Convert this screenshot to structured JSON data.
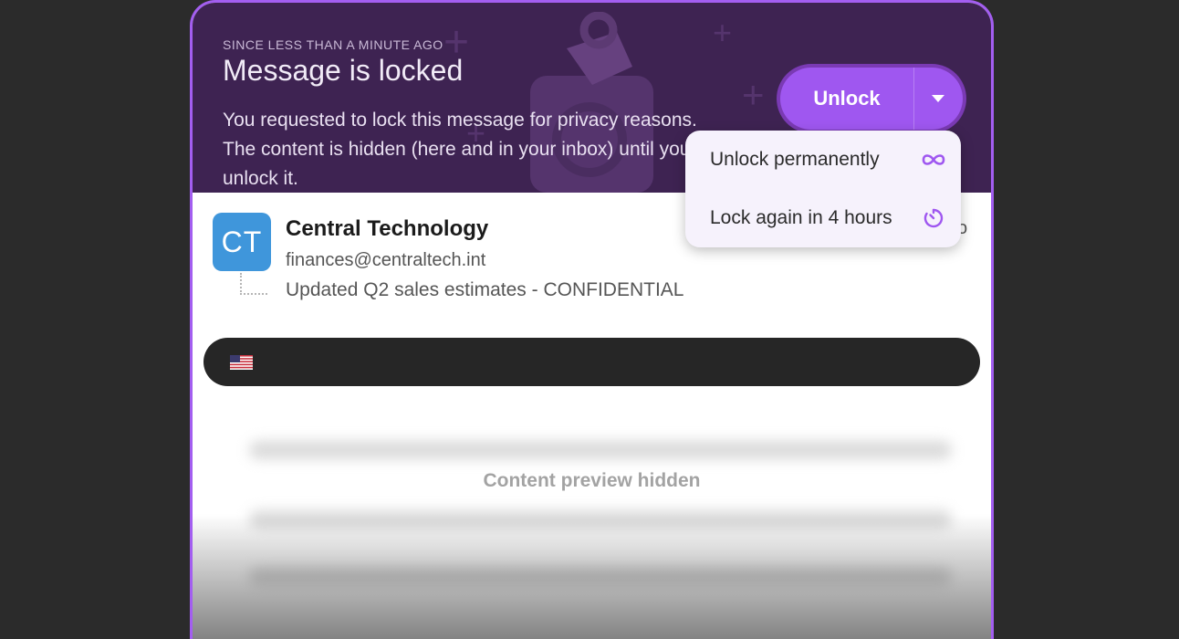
{
  "banner": {
    "since": "SINCE LESS THAN A MINUTE AGO",
    "title": "Message is locked",
    "description": "You requested to lock this message for privacy reasons. The content is hidden (here and in your inbox) until you unlock it."
  },
  "unlock_button": {
    "label": "Unlock"
  },
  "dropdown": {
    "items": [
      {
        "label": "Unlock permanently",
        "icon": "infinity-icon"
      },
      {
        "label": "Lock again in 4 hours",
        "icon": "timer-icon"
      }
    ]
  },
  "message": {
    "avatar_initials": "CT",
    "sender_name": "Central Technology",
    "sender_email": "finances@centraltech.int",
    "subject": "Updated Q2 sales estimates - CONFIDENTIAL",
    "time_fragment": "o"
  },
  "language_bar": {
    "flag_icon": "us-flag-icon"
  },
  "content": {
    "preview_hidden": "Content preview hidden"
  },
  "colors": {
    "accent": "#9f57f0",
    "banner_bg": "#3e2352",
    "avatar": "#3f96db",
    "page_bg": "#2b2b2b"
  }
}
